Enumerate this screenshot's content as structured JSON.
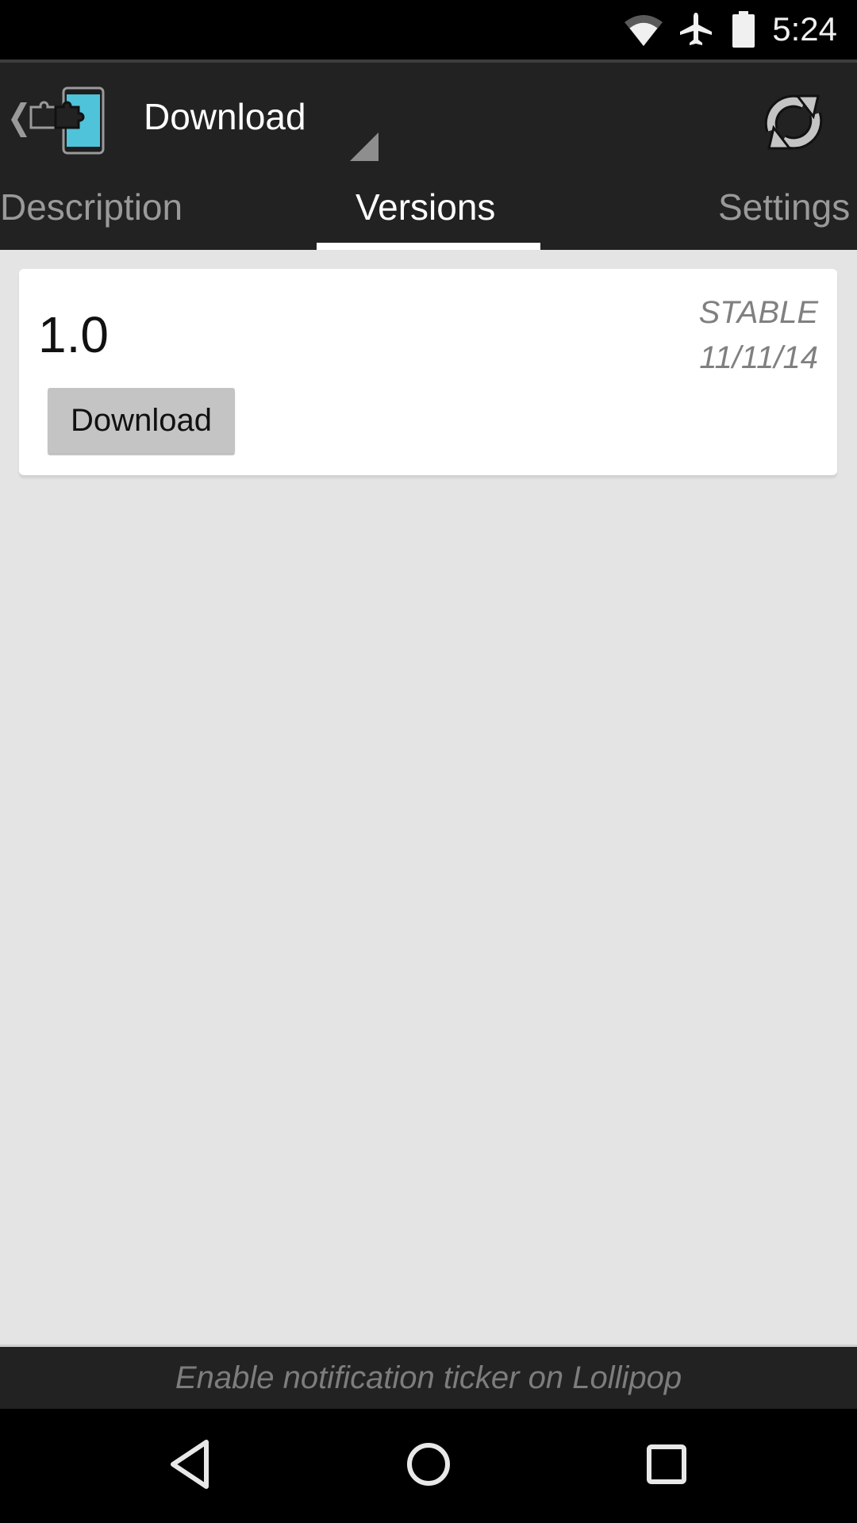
{
  "status_bar": {
    "time": "5:24",
    "icons": [
      "wifi-icon",
      "airplane-mode-icon",
      "battery-icon"
    ]
  },
  "action_bar": {
    "title": "Download",
    "up_icon": "chevron-left-icon",
    "app_icon": "xposed-installer-puzzle-icon",
    "refresh_icon": "refresh-icon",
    "colors": {
      "accent": "#4fc3d9",
      "background": "#222222"
    }
  },
  "tabs": [
    {
      "label": "Description",
      "active": false
    },
    {
      "label": "Versions",
      "active": true
    },
    {
      "label": "Settings",
      "active": false
    }
  ],
  "versions": [
    {
      "version": "1.0",
      "channel": "STABLE",
      "date": "11/11/14",
      "button_label": "Download"
    }
  ],
  "ticker": {
    "text": "Enable notification ticker on Lollipop"
  },
  "nav_bar": {
    "buttons": [
      "back-icon",
      "home-icon",
      "recents-icon"
    ]
  }
}
